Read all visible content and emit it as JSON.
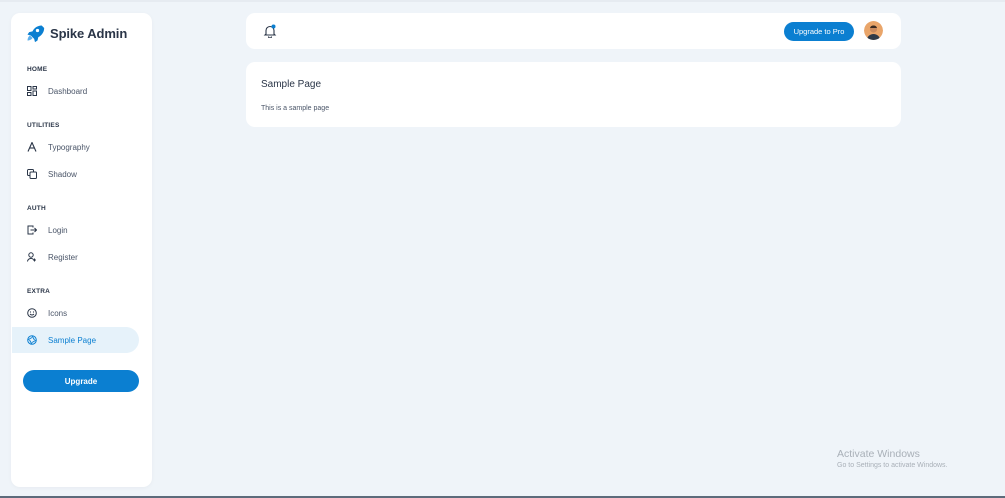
{
  "brand": {
    "name": "Spike Admin",
    "icon": "rocket-icon",
    "accent": "#0b7fd1"
  },
  "sidebar": {
    "sections": [
      {
        "label": "HOME"
      },
      {
        "label": "UTILITIES"
      },
      {
        "label": "AUTH"
      },
      {
        "label": "EXTRA"
      }
    ],
    "items": [
      {
        "label": "Dashboard",
        "icon": "dashboard-icon"
      },
      {
        "label": "Typography",
        "icon": "typography-icon"
      },
      {
        "label": "Shadow",
        "icon": "copy-icon"
      },
      {
        "label": "Login",
        "icon": "login-icon"
      },
      {
        "label": "Register",
        "icon": "user-plus-icon"
      },
      {
        "label": "Icons",
        "icon": "mood-icon"
      },
      {
        "label": "Sample Page",
        "icon": "aperture-icon",
        "active": true
      }
    ],
    "upgrade_label": "Upgrade"
  },
  "header": {
    "notification_icon": "bell-icon",
    "upgrade_pro_label": "Upgrade to Pro",
    "avatar": "user-avatar"
  },
  "main": {
    "title": "Sample Page",
    "body": "This is a sample page"
  },
  "watermark": {
    "line1": "Activate Windows",
    "line2": "Go to Settings to activate Windows."
  }
}
